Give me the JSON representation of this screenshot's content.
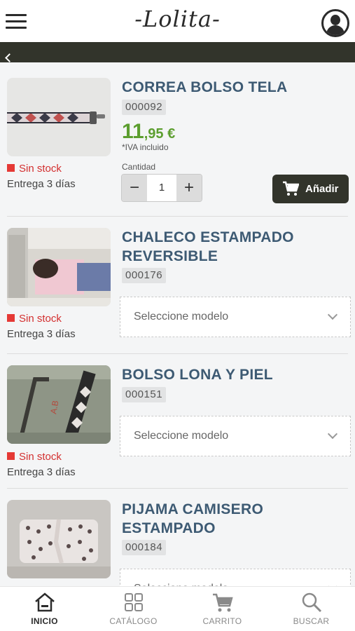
{
  "header": {
    "logo_text": "-Lolita-"
  },
  "products": [
    {
      "title": "CORREA BOLSO TELA",
      "code": "000092",
      "stock_status": "Sin stock",
      "delivery": "Entrega 3 días",
      "price_int": "11",
      "price_dec": ",95 €",
      "tax_note": "*IVA incluido",
      "qty_label": "Cantidad",
      "qty_value": "1",
      "add_label": "Añadir"
    },
    {
      "title": "CHALECO ESTAMPADO REVERSIBLE",
      "code": "000176",
      "stock_status": "Sin stock",
      "delivery": "Entrega 3 días",
      "select_placeholder": "Seleccione modelo"
    },
    {
      "title": "BOLSO LONA Y PIEL",
      "code": "000151",
      "stock_status": "Sin stock",
      "delivery": "Entrega 3 días",
      "select_placeholder": "Seleccione modelo"
    },
    {
      "title": "PIJAMA CAMISERO ESTAMPADO",
      "code": "000184",
      "select_placeholder": "Seleccione modelo"
    }
  ],
  "bottom_nav": [
    {
      "label": "INICIO",
      "icon": "home-icon",
      "active": true
    },
    {
      "label": "CATÁLOGO",
      "icon": "grid-icon",
      "active": false
    },
    {
      "label": "CARRITO",
      "icon": "cart-icon",
      "active": false
    },
    {
      "label": "BUSCAR",
      "icon": "search-icon",
      "active": false
    }
  ],
  "colors": {
    "accent_dark": "#32342b",
    "title_blue": "#3d5a73",
    "price_green": "#5c9e2f",
    "stock_red": "#e53935"
  }
}
